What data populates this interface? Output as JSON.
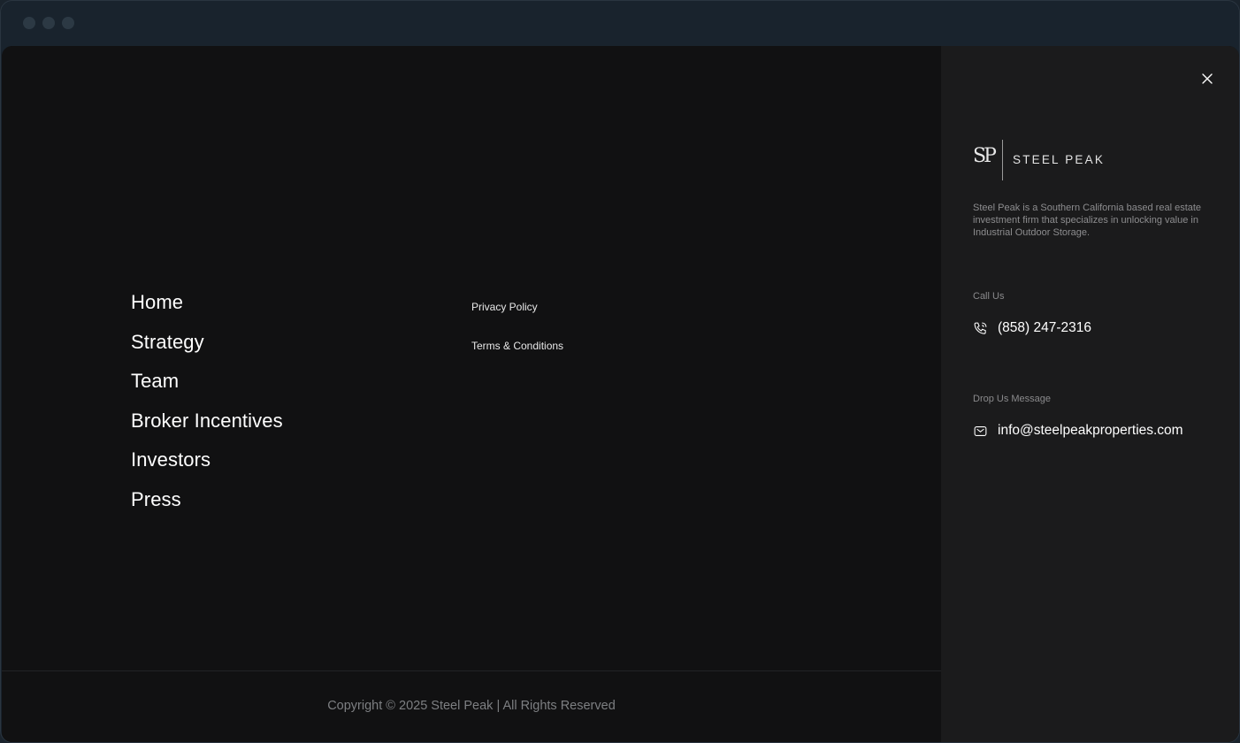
{
  "nav": {
    "items": [
      {
        "label": "Home"
      },
      {
        "label": "Strategy"
      },
      {
        "label": "Team"
      },
      {
        "label": "Broker Incentives"
      },
      {
        "label": "Investors"
      },
      {
        "label": "Press"
      }
    ]
  },
  "legal": {
    "privacy": "Privacy Policy",
    "terms": "Terms & Conditions"
  },
  "footer": {
    "copyright": "Copyright © 2025 Steel Peak | All Rights Reserved"
  },
  "side": {
    "close_icon": "close-icon",
    "logo": {
      "mark": "SP",
      "text": "STEEL PEAK"
    },
    "description": "Steel Peak is a Southern California based real estate investment firm that specializes in unlocking value in Industrial Outdoor Storage.",
    "call_label": "Call Us",
    "phone": "(858) 247-2316",
    "phone_icon": "phone-icon",
    "message_label": "Drop Us Message",
    "email": "info@steelpeakproperties.com",
    "email_icon": "mail-icon"
  },
  "colors": {
    "background": "#111112",
    "side_panel": "#1b1b1c",
    "text": "#ffffff",
    "muted": "#8a8a8c"
  }
}
